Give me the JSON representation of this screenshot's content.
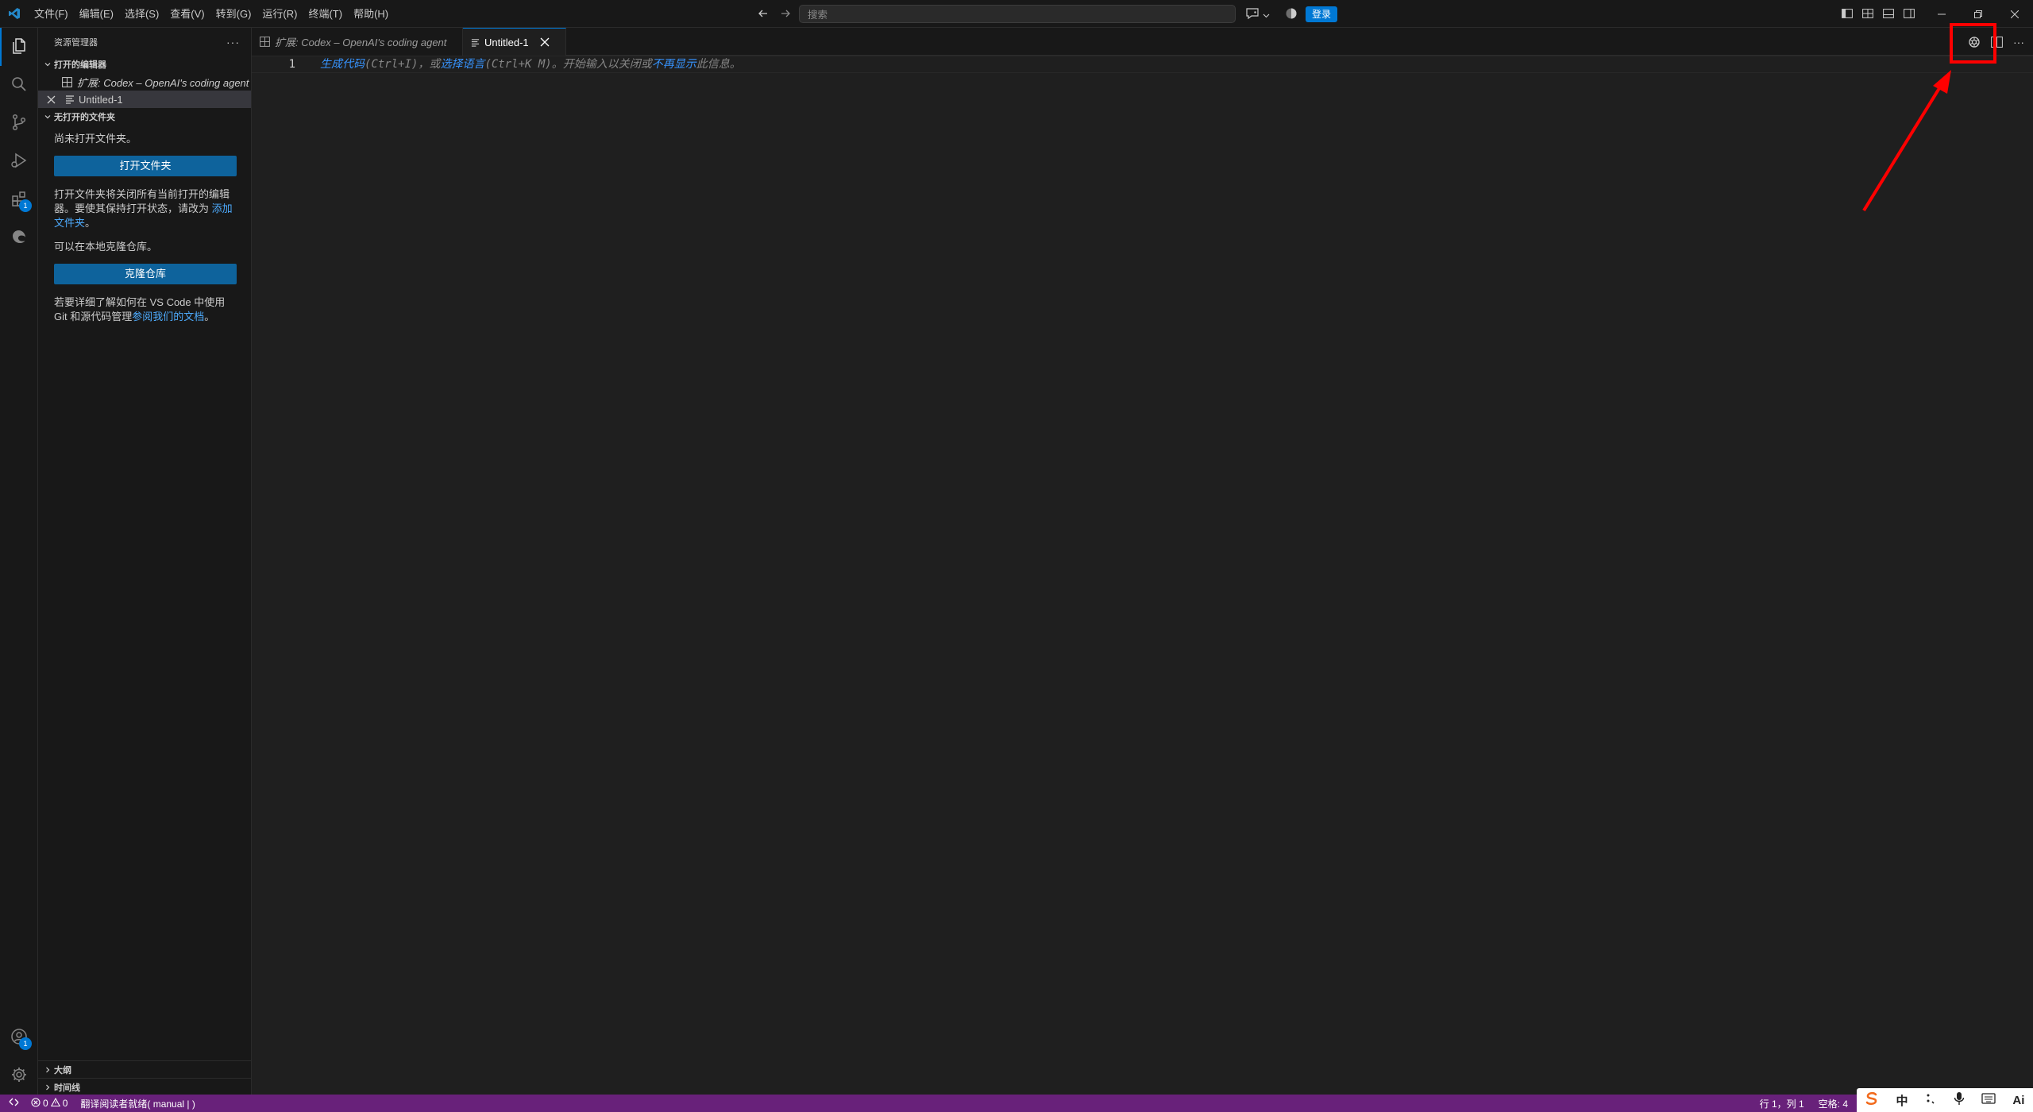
{
  "menubar": {
    "items": [
      "文件(F)",
      "编辑(E)",
      "选择(S)",
      "查看(V)",
      "转到(G)",
      "运行(R)",
      "终端(T)",
      "帮助(H)"
    ]
  },
  "titlebar": {
    "search_placeholder": "搜索",
    "signin_label": "登录"
  },
  "sidebar": {
    "title": "资源管理器",
    "open_editors": {
      "header": "打开的编辑器",
      "items": [
        {
          "label": "扩展: Codex – OpenAI's coding agent",
          "icon": "extension-icon"
        },
        {
          "label": "Untitled-1",
          "icon": "text-file-icon"
        }
      ]
    },
    "no_folder": {
      "header": "无打开的文件夹",
      "msg1": "尚未打开文件夹。",
      "open_folder_button": "打开文件夹",
      "msg2_prefix": "打开文件夹将关闭所有当前打开的编辑器。要使其保持打开状态，请改为 ",
      "msg2_link": "添加文件夹",
      "msg2_suffix": "。",
      "msg3": "可以在本地克隆仓库。",
      "clone_button": "克隆仓库",
      "msg4_prefix": "若要详细了解如何在 VS Code 中使用 Git 和源代码管理",
      "msg4_link": "参阅我们的文档",
      "msg4_suffix": "。"
    },
    "outline": "大纲",
    "timeline": "时间线"
  },
  "activitybar": {
    "extensions_badge": "1",
    "accounts_badge": "1"
  },
  "tabs": [
    {
      "label": "扩展: Codex – OpenAI's coding agent",
      "active": false
    },
    {
      "label": "Untitled-1",
      "active": true
    }
  ],
  "editor": {
    "line_number": "1",
    "hint": {
      "link1": "生成代码",
      "text1": "(Ctrl+I)，或",
      "link2": "选择语言",
      "text2": "(Ctrl+K M)。开始输入以关闭或",
      "link3": "不再显示",
      "text3": "此信息。"
    }
  },
  "statusbar": {
    "errors": "0",
    "warnings": "0",
    "message": "翻译阅读者就绪( manual | )",
    "position": "行 1，列 1",
    "spaces": "空格: 4"
  },
  "ime": {
    "lang": "中",
    "ai": "Ai"
  },
  "colors": {
    "accent": "#0078d4",
    "statusbar": "#68217a",
    "annotation": "#ff0000"
  }
}
